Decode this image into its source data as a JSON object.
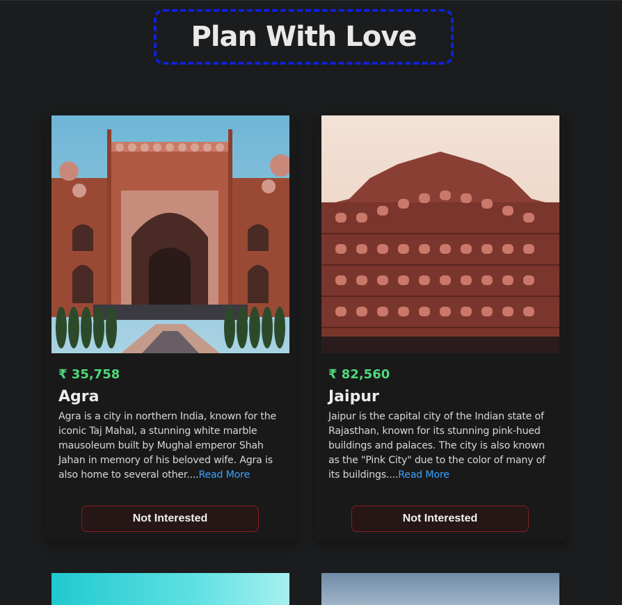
{
  "header": {
    "title": "Plan With Love"
  },
  "cards": [
    {
      "price": "₹ 35,758",
      "city": "Agra",
      "description": "Agra is a city in northern India, known for the iconic Taj Mahal, a stunning white marble mausoleum built by Mughal emperor Shah Jahan in memory of his beloved wife. Agra is also home to several other....",
      "read_more": "Read More",
      "button": "Not Interested"
    },
    {
      "price": "₹ 82,560",
      "city": "Jaipur",
      "description": "Jaipur is the capital city of the Indian state of Rajasthan, known for its stunning pink-hued buildings and palaces. The city is also known as the \"Pink City\" due to the color of many of its buildings....",
      "read_more": "Read More",
      "button": "Not Interested"
    }
  ],
  "colors": {
    "background": "#1b1c1d",
    "title_border": "#1020d8",
    "price": "#4fd97a",
    "link": "#3aa2ff",
    "button_border": "#8a1e1e"
  }
}
